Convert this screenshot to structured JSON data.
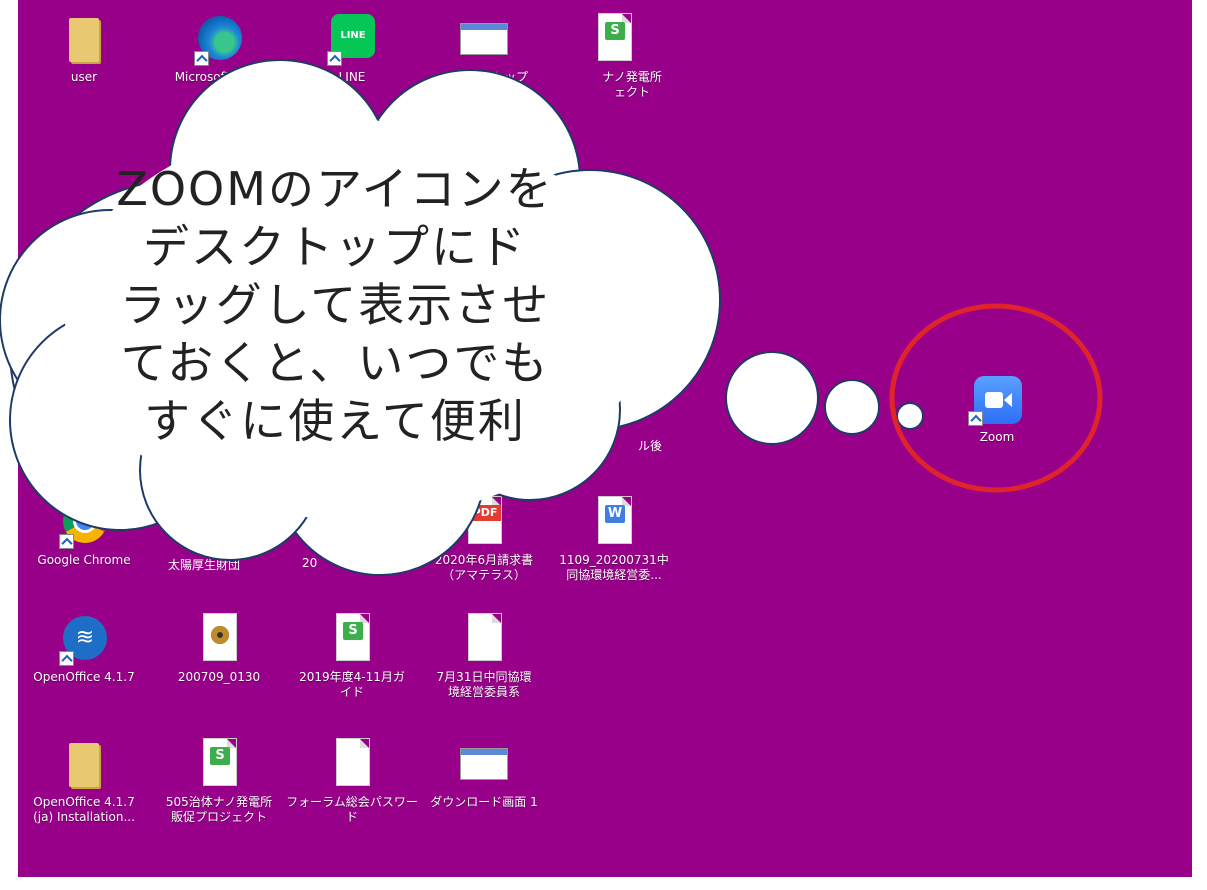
{
  "desktop": {
    "background": "#99008a",
    "icons": [
      {
        "id": "user",
        "label": "user",
        "type": "folder"
      },
      {
        "id": "edge",
        "label": "Microsoft Edge",
        "type": "edge"
      },
      {
        "id": "line",
        "label": "LINE",
        "type": "line"
      },
      {
        "id": "desktop_top",
        "label": "ットップ",
        "type": "thumb"
      },
      {
        "id": "solar",
        "label": "ナノ発電所\nェクト",
        "type": "sheet"
      },
      {
        "id": "after",
        "label": "ル後",
        "type": "hidden"
      },
      {
        "id": "zoom",
        "label": "Zoom",
        "type": "zoom"
      },
      {
        "id": "chrome",
        "label": "Google Chrome",
        "type": "chrome"
      },
      {
        "id": "taiyo",
        "label": "太陽厚生財団",
        "type": "hidden"
      },
      {
        "id": "num20",
        "label": "20",
        "type": "hidden"
      },
      {
        "id": "invoice",
        "label": "2020年6月請求書\n（アマテラス）",
        "type": "pdf"
      },
      {
        "id": "doc1109",
        "label": "1109_20200731中\n同協環境経営委...",
        "type": "word"
      },
      {
        "id": "openoffice",
        "label": "OpenOffice 4.1.7",
        "type": "ooo"
      },
      {
        "id": "audio",
        "label": "200709_0130",
        "type": "disc"
      },
      {
        "id": "guide",
        "label": "2019年度4-11月ガ\nイド",
        "type": "sheet"
      },
      {
        "id": "july31",
        "label": "7月31日中同協環\n境経営委員系",
        "type": "doc"
      },
      {
        "id": "oo_install",
        "label": "OpenOffice 4.1.7\n(ja) Installation...",
        "type": "folder"
      },
      {
        "id": "sales",
        "label": "505治体ナノ発電所\n販促プロジェクト",
        "type": "sheet"
      },
      {
        "id": "forum",
        "label": "フォーラム総会パスワー\nド",
        "type": "doc"
      },
      {
        "id": "download",
        "label": "ダウンロード画面 1",
        "type": "thumb"
      }
    ]
  },
  "annotation": {
    "cloud_text": "ZOOMのアイコンを\nデスクトップにド\nラッグして表示させ\nておくと、いつでも\nすぐに使えて便利",
    "highlight_color": "#e0242b"
  },
  "colors": {
    "line_green": "#06c755",
    "sheet_green": "#3cae4c",
    "word_blue": "#3f7fe0",
    "pdf_red": "#e33b2f",
    "zoom_blue": "#2d6ef5"
  }
}
